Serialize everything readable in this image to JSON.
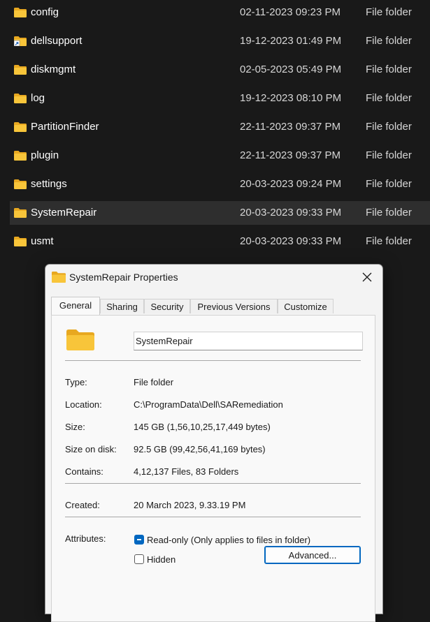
{
  "explorer": {
    "rows": [
      {
        "name": "config",
        "date": "02-11-2023 09:23 PM",
        "type": "File folder",
        "shortcut": false,
        "selected": false
      },
      {
        "name": "dellsupport",
        "date": "19-12-2023 01:49 PM",
        "type": "File folder",
        "shortcut": true,
        "selected": false
      },
      {
        "name": "diskmgmt",
        "date": "02-05-2023 05:49 PM",
        "type": "File folder",
        "shortcut": false,
        "selected": false
      },
      {
        "name": "log",
        "date": "19-12-2023 08:10 PM",
        "type": "File folder",
        "shortcut": false,
        "selected": false
      },
      {
        "name": "PartitionFinder",
        "date": "22-11-2023 09:37 PM",
        "type": "File folder",
        "shortcut": false,
        "selected": false
      },
      {
        "name": "plugin",
        "date": "22-11-2023 09:37 PM",
        "type": "File folder",
        "shortcut": false,
        "selected": false
      },
      {
        "name": "settings",
        "date": "20-03-2023 09:24 PM",
        "type": "File folder",
        "shortcut": false,
        "selected": false
      },
      {
        "name": "SystemRepair",
        "date": "20-03-2023 09:33 PM",
        "type": "File folder",
        "shortcut": false,
        "selected": true
      },
      {
        "name": "usmt",
        "date": "20-03-2023 09:33 PM",
        "type": "File folder",
        "shortcut": false,
        "selected": false
      }
    ]
  },
  "dialog": {
    "title": "SystemRepair Properties",
    "close_icon": "close-icon",
    "tabs": [
      {
        "label": "General",
        "active": true
      },
      {
        "label": "Sharing",
        "active": false
      },
      {
        "label": "Security",
        "active": false
      },
      {
        "label": "Previous Versions",
        "active": false
      },
      {
        "label": "Customize",
        "active": false
      }
    ],
    "general": {
      "folder_name": "SystemRepair",
      "type_label": "Type:",
      "type_value": "File folder",
      "location_label": "Location:",
      "location_value": "C:\\ProgramData\\Dell\\SARemediation",
      "size_label": "Size:",
      "size_value": "145 GB (1,56,10,25,17,449 bytes)",
      "size_on_disk_label": "Size on disk:",
      "size_on_disk_value": "92.5 GB (99,42,56,41,169 bytes)",
      "contains_label": "Contains:",
      "contains_value": "4,12,137 Files, 83 Folders",
      "created_label": "Created:",
      "created_value": "20 March 2023, 9.33.19 PM",
      "attributes_label": "Attributes:",
      "readonly_label": "Read-only (Only applies to files in folder)",
      "readonly_state": "indeterminate",
      "hidden_label": "Hidden",
      "hidden_state": "unchecked",
      "advanced_label": "Advanced..."
    }
  },
  "colors": {
    "explorer_bg": "#191919",
    "folder_yellow": "#f8c53a",
    "accent": "#0067c0"
  }
}
